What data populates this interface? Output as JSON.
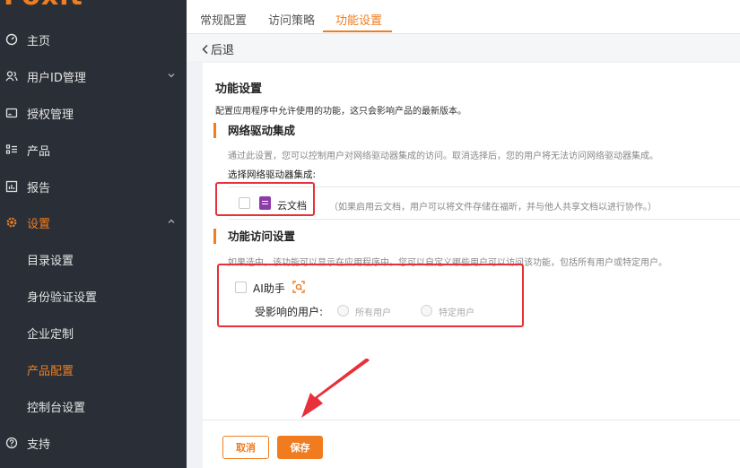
{
  "brand": {
    "logo_text": "Foxit",
    "accent": "#ef7d22"
  },
  "sidebar": {
    "items": [
      {
        "label": "主页",
        "icon": "dashboard-icon"
      },
      {
        "label": "用户ID管理",
        "icon": "users-icon"
      },
      {
        "label": "授权管理",
        "icon": "license-icon"
      },
      {
        "label": "产品",
        "icon": "product-list-icon"
      },
      {
        "label": "报告",
        "icon": "report-icon"
      },
      {
        "label": "设置",
        "icon": "gear-icon"
      }
    ],
    "settings_children": [
      "目录设置",
      "身份验证设置",
      "企业定制",
      "产品配置",
      "控制台设置"
    ],
    "support": {
      "label": "支持",
      "icon": "help-icon"
    }
  },
  "tabs": [
    "常规配置",
    "访问策略",
    "功能设置"
  ],
  "back_label": "后退",
  "page": {
    "title": "功能设置",
    "description": "配置应用程序中允许使用的功能，这只会影响产品的最新版本。"
  },
  "network_drive": {
    "section_title": "网络驱动集成",
    "hint": "通过此设置，您可以控制用户对网络驱动器集成的访问。取消选择后，您的用户将无法访问网络驱动器集成。",
    "select_label": "选择网络驱动器集成:",
    "option": {
      "name": "云文档",
      "note": "（如果启用云文档，用户可以将文件存储在福昕，并与他人共享文档以进行协作。）",
      "checked": false
    }
  },
  "feature_access": {
    "section_title": "功能访问设置",
    "hint": "如果选中，该功能可以显示在应用程序中。您可以自定义哪些用户可以访问该功能，包括所有用户或特定用户。",
    "feature": {
      "name": "AI助手",
      "checked": false
    },
    "affected_label": "受影响的用户:",
    "options": [
      "所有用户",
      "特定用户"
    ]
  },
  "footer": {
    "cancel_label": "取消",
    "save_label": "保存"
  }
}
